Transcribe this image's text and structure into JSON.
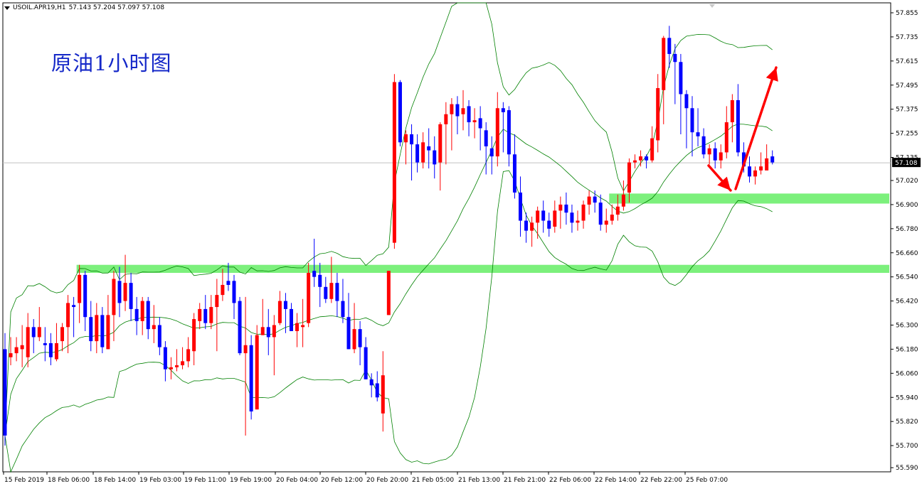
{
  "header": {
    "symbol_timeframe": "USOIL.APR19,H1",
    "ohlc": "57.143 57.204 57.097 57.108"
  },
  "overlay_title": "原油1小时图",
  "colors": {
    "bull": "#ff0000",
    "bear": "#0000ff",
    "band": "#008000",
    "zone": "#7cf07c",
    "arrow": "#ff0000"
  },
  "chart_data": {
    "type": "candlestick",
    "y_ticks": [
      "57.855",
      "57.735",
      "57.615",
      "57.495",
      "57.375",
      "57.255",
      "57.135",
      "57.020",
      "56.900",
      "56.780",
      "56.660",
      "56.540",
      "56.420",
      "56.300",
      "56.180",
      "56.060",
      "55.940",
      "55.820",
      "55.700",
      "55.590"
    ],
    "x_labels": [
      "15 Feb 2019",
      "18 Feb 06:00",
      "18 Feb 14:00",
      "19 Feb 03:00",
      "19 Feb 11:00",
      "19 Feb 19:00",
      "20 Feb 04:00",
      "20 Feb 12:00",
      "20 Feb 20:00",
      "21 Feb 05:00",
      "21 Feb 13:00",
      "21 Feb 21:00",
      "22 Feb 06:00",
      "22 Feb 14:00",
      "22 Feb 22:00",
      "25 Feb 07:00"
    ],
    "ylim": [
      55.59,
      57.88
    ],
    "current_price": "57.108",
    "support_zones": [
      {
        "from": 56.905,
        "to": 56.955,
        "start_bar": 106
      },
      {
        "from": 56.56,
        "to": 56.6,
        "start_bar": 13
      }
    ],
    "candles": [
      [
        56.18,
        55.75,
        56.26,
        55.7
      ],
      [
        56.14,
        56.16,
        56.24,
        56.1
      ],
      [
        56.16,
        56.19,
        56.24,
        56.12
      ],
      [
        56.18,
        56.2,
        56.3,
        56.09
      ],
      [
        56.14,
        56.29,
        56.36,
        56.09
      ],
      [
        56.29,
        56.24,
        56.33,
        56.16
      ],
      [
        56.24,
        56.29,
        56.39,
        56.22
      ],
      [
        56.21,
        56.2,
        56.29,
        56.12
      ],
      [
        56.21,
        56.14,
        56.26,
        56.1
      ],
      [
        56.13,
        56.21,
        56.31,
        56.12
      ],
      [
        56.22,
        56.29,
        56.31,
        56.17
      ],
      [
        56.29,
        56.41,
        56.45,
        56.16
      ],
      [
        56.4,
        56.39,
        56.44,
        56.24
      ],
      [
        56.41,
        56.55,
        56.6,
        56.31
      ],
      [
        56.55,
        56.34,
        56.57,
        56.27
      ],
      [
        56.34,
        56.22,
        56.42,
        56.17
      ],
      [
        56.22,
        56.35,
        56.41,
        56.16
      ],
      [
        56.35,
        56.19,
        56.39,
        56.16
      ],
      [
        56.18,
        56.35,
        56.45,
        56.18
      ],
      [
        56.35,
        56.53,
        56.57,
        56.22
      ],
      [
        56.52,
        56.41,
        56.59,
        56.34
      ],
      [
        56.42,
        56.51,
        56.65,
        56.37
      ],
      [
        56.51,
        56.38,
        56.56,
        56.32
      ],
      [
        56.38,
        56.32,
        56.44,
        56.25
      ],
      [
        56.32,
        56.42,
        56.44,
        56.25
      ],
      [
        56.42,
        56.28,
        56.44,
        56.23
      ],
      [
        56.28,
        56.3,
        56.4,
        56.21
      ],
      [
        56.3,
        56.19,
        56.34,
        56.15
      ],
      [
        56.19,
        56.08,
        56.22,
        56.02
      ],
      [
        56.08,
        56.09,
        56.14,
        56.03
      ],
      [
        56.09,
        56.1,
        56.18,
        56.07
      ],
      [
        56.1,
        56.12,
        56.19,
        56.08
      ],
      [
        56.12,
        56.18,
        56.24,
        56.09
      ],
      [
        56.17,
        56.33,
        56.36,
        56.1
      ],
      [
        56.32,
        56.38,
        56.41,
        56.28
      ],
      [
        56.38,
        56.31,
        56.45,
        56.28
      ],
      [
        56.31,
        56.39,
        56.45,
        56.28
      ],
      [
        56.39,
        56.45,
        56.53,
        56.17
      ],
      [
        56.45,
        56.5,
        56.58,
        56.42
      ],
      [
        56.52,
        56.5,
        56.61,
        56.47
      ],
      [
        56.52,
        56.41,
        56.55,
        56.33
      ],
      [
        56.42,
        56.16,
        56.44,
        56.15
      ],
      [
        56.16,
        56.2,
        56.44,
        55.75
      ],
      [
        56.2,
        55.87,
        56.25,
        55.83
      ],
      [
        55.88,
        56.25,
        56.3,
        55.88
      ],
      [
        56.25,
        56.29,
        56.43,
        56.25
      ],
      [
        56.29,
        56.24,
        56.38,
        56.15
      ],
      [
        56.24,
        56.3,
        56.35,
        56.05
      ],
      [
        56.31,
        56.42,
        56.47,
        56.3
      ],
      [
        56.42,
        56.38,
        56.46,
        56.26
      ],
      [
        56.38,
        56.27,
        56.41,
        56.27
      ],
      [
        56.27,
        56.31,
        56.36,
        56.19
      ],
      [
        56.29,
        56.3,
        56.43,
        56.19
      ],
      [
        56.31,
        56.56,
        56.61,
        56.29
      ],
      [
        56.57,
        56.54,
        56.73,
        56.49
      ],
      [
        56.55,
        56.49,
        56.61,
        56.39
      ],
      [
        56.49,
        56.43,
        56.54,
        56.41
      ],
      [
        56.43,
        56.51,
        56.64,
        56.41
      ],
      [
        56.51,
        56.42,
        56.56,
        56.34
      ],
      [
        56.42,
        56.34,
        56.53,
        56.31
      ],
      [
        56.34,
        56.18,
        56.46,
        56.18
      ],
      [
        56.18,
        56.28,
        56.41,
        56.16
      ],
      [
        56.28,
        56.19,
        56.32,
        56.1
      ],
      [
        56.19,
        56.03,
        56.24,
        56.03
      ],
      [
        56.03,
        56.0,
        56.06,
        55.94
      ],
      [
        56.01,
        55.94,
        56.07,
        55.92
      ],
      [
        55.86,
        56.05,
        56.17,
        55.77
      ],
      [
        56.35,
        56.57,
        56.57,
        56.35
      ],
      [
        56.71,
        57.51,
        57.55,
        56.68
      ],
      [
        57.51,
        57.21,
        57.52,
        57.19
      ],
      [
        57.21,
        57.25,
        57.27,
        57.1
      ],
      [
        57.25,
        57.2,
        57.3,
        57.02
      ],
      [
        57.2,
        57.11,
        57.25,
        57.06
      ],
      [
        57.11,
        57.21,
        57.26,
        57.08
      ],
      [
        57.19,
        57.17,
        57.28,
        57.08
      ],
      [
        57.17,
        57.1,
        57.24,
        57.03
      ],
      [
        57.11,
        57.3,
        57.31,
        56.97
      ],
      [
        57.3,
        57.35,
        57.41,
        57.1
      ],
      [
        57.35,
        57.4,
        57.43,
        57.17
      ],
      [
        57.4,
        57.34,
        57.44,
        57.25
      ],
      [
        57.35,
        57.38,
        57.47,
        57.27
      ],
      [
        57.39,
        57.31,
        57.42,
        57.24
      ],
      [
        57.31,
        57.32,
        57.38,
        57.23
      ],
      [
        57.33,
        57.28,
        57.39,
        57.17
      ],
      [
        57.27,
        57.19,
        57.31,
        57.05
      ],
      [
        57.18,
        57.14,
        57.24,
        57.05
      ],
      [
        57.14,
        57.38,
        57.46,
        57.09
      ],
      [
        57.38,
        57.36,
        57.41,
        57.16
      ],
      [
        57.37,
        57.15,
        57.39,
        57.09
      ],
      [
        57.15,
        56.96,
        57.25,
        56.93
      ],
      [
        56.96,
        56.82,
        57.04,
        56.74
      ],
      [
        56.82,
        56.77,
        56.86,
        56.71
      ],
      [
        56.77,
        56.81,
        56.84,
        56.69
      ],
      [
        56.81,
        56.87,
        56.89,
        56.73
      ],
      [
        56.87,
        56.82,
        56.92,
        56.76
      ],
      [
        56.82,
        56.78,
        56.86,
        56.74
      ],
      [
        56.79,
        56.87,
        56.92,
        56.76
      ],
      [
        56.87,
        56.9,
        56.94,
        56.78
      ],
      [
        56.9,
        56.86,
        56.96,
        56.8
      ],
      [
        56.86,
        56.81,
        56.9,
        56.76
      ],
      [
        56.81,
        56.82,
        56.87,
        56.77
      ],
      [
        56.82,
        56.9,
        56.92,
        56.78
      ],
      [
        56.9,
        56.94,
        56.97,
        56.85
      ],
      [
        56.94,
        56.91,
        56.97,
        56.86
      ],
      [
        56.91,
        56.8,
        56.95,
        56.77
      ],
      [
        56.8,
        56.82,
        56.88,
        56.76
      ],
      [
        56.82,
        56.85,
        56.9,
        56.8
      ],
      [
        56.85,
        56.89,
        56.95,
        56.82
      ],
      [
        56.89,
        56.95,
        57.02,
        56.87
      ],
      [
        56.96,
        57.11,
        57.13,
        56.91
      ],
      [
        57.11,
        57.12,
        57.15,
        57.08
      ],
      [
        57.12,
        57.14,
        57.17,
        57.09
      ],
      [
        57.14,
        57.12,
        57.15,
        57.08
      ],
      [
        57.12,
        57.23,
        57.29,
        57.11
      ],
      [
        57.22,
        57.48,
        57.55,
        57.16
      ],
      [
        57.47,
        57.73,
        57.74,
        57.3
      ],
      [
        57.73,
        57.65,
        57.79,
        57.58
      ],
      [
        57.65,
        57.61,
        57.7,
        57.4
      ],
      [
        57.61,
        57.45,
        57.65,
        57.25
      ],
      [
        57.45,
        57.38,
        57.47,
        57.18
      ],
      [
        57.38,
        57.26,
        57.44,
        57.14
      ],
      [
        57.26,
        57.24,
        57.38,
        57.19
      ],
      [
        57.24,
        57.15,
        57.28,
        57.13
      ],
      [
        57.15,
        57.18,
        57.2,
        57.1
      ],
      [
        57.18,
        57.12,
        57.21,
        57.08
      ],
      [
        57.12,
        57.16,
        57.2,
        57.08
      ],
      [
        57.16,
        57.31,
        57.39,
        57.13
      ],
      [
        57.31,
        57.42,
        57.45,
        57.21
      ],
      [
        57.42,
        57.16,
        57.5,
        57.14
      ],
      [
        57.16,
        57.09,
        57.21,
        57.06
      ],
      [
        57.09,
        57.04,
        57.14,
        57.01
      ],
      [
        57.04,
        57.07,
        57.09,
        57.0
      ],
      [
        57.07,
        57.09,
        57.16,
        57.05
      ],
      [
        57.07,
        57.13,
        57.2,
        57.08
      ],
      [
        57.14,
        57.11,
        57.17,
        57.1
      ]
    ]
  }
}
